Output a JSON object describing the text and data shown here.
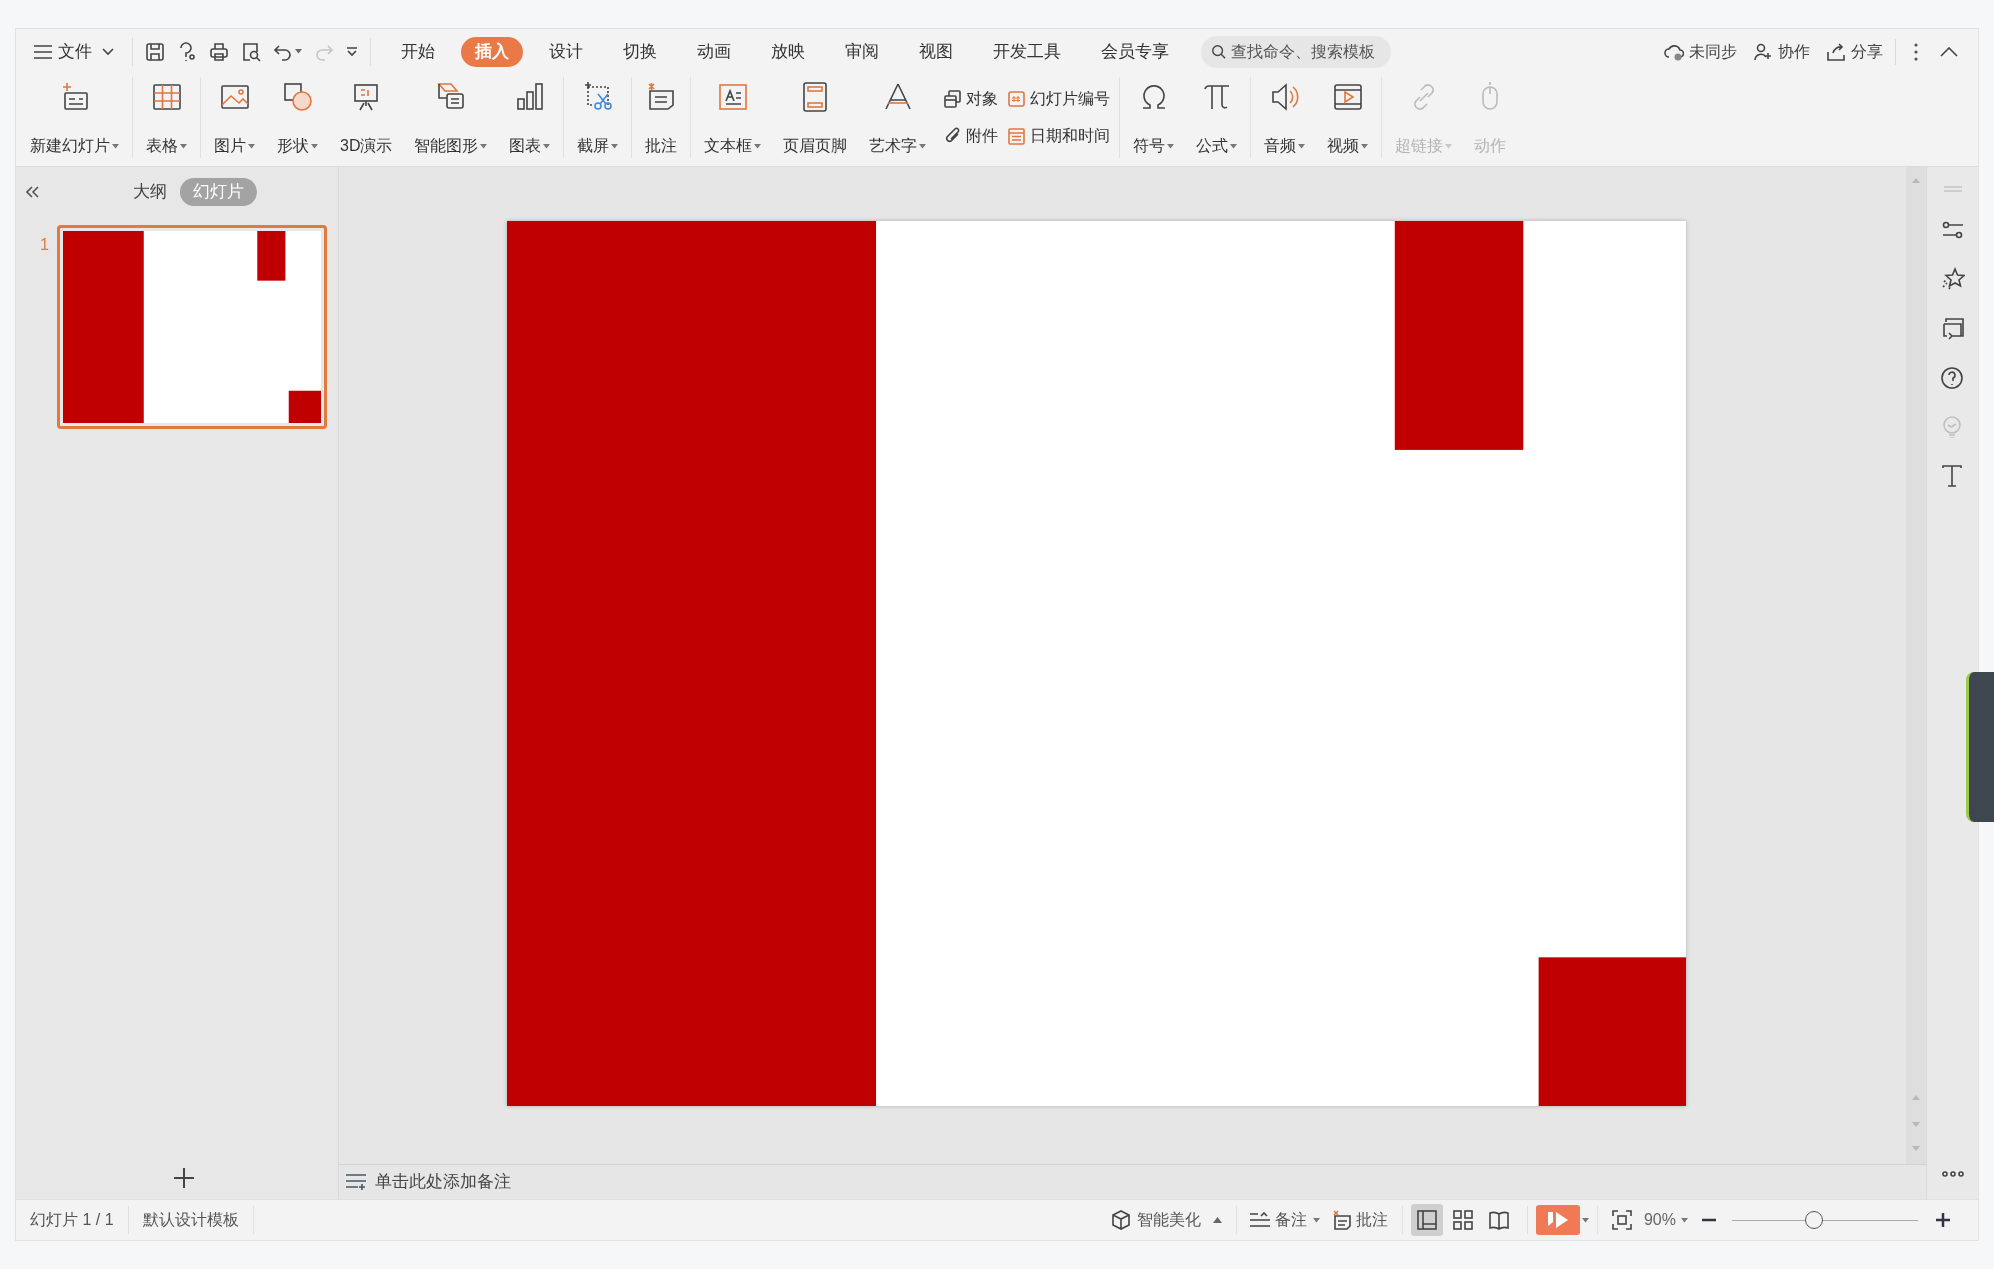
{
  "file_menu": {
    "label": "文件"
  },
  "tabs": [
    {
      "label": "开始",
      "selected": false
    },
    {
      "label": "插入",
      "selected": true
    },
    {
      "label": "设计",
      "selected": false
    },
    {
      "label": "切换",
      "selected": false
    },
    {
      "label": "动画",
      "selected": false
    },
    {
      "label": "放映",
      "selected": false
    },
    {
      "label": "审阅",
      "selected": false
    },
    {
      "label": "视图",
      "selected": false
    },
    {
      "label": "开发工具",
      "selected": false
    },
    {
      "label": "会员专享",
      "selected": false
    }
  ],
  "search": {
    "placeholder": "查找命令、搜索模板"
  },
  "top_actions": [
    "未同步",
    "协作",
    "分享"
  ],
  "ribbon": [
    {
      "items": [
        {
          "kind": "large",
          "label": "新建幻灯片",
          "dropdown": true,
          "disabled": false
        }
      ]
    },
    {
      "items": [
        {
          "kind": "large",
          "label": "表格",
          "dropdown": true,
          "disabled": false
        }
      ]
    },
    {
      "items": [
        {
          "kind": "large",
          "label": "图片",
          "dropdown": true,
          "disabled": false
        },
        {
          "kind": "large",
          "label": "形状",
          "dropdown": true,
          "disabled": false
        },
        {
          "kind": "large",
          "label": "3D演示",
          "dropdown": false,
          "disabled": false
        },
        {
          "kind": "large",
          "label": "智能图形",
          "dropdown": true,
          "disabled": false
        },
        {
          "kind": "large",
          "label": "图表",
          "dropdown": true,
          "disabled": false
        }
      ]
    },
    {
      "items": [
        {
          "kind": "large",
          "label": "截屏",
          "dropdown": true,
          "disabled": false
        }
      ]
    },
    {
      "items": [
        {
          "kind": "large",
          "label": "批注",
          "dropdown": false,
          "disabled": false
        }
      ]
    },
    {
      "items": [
        {
          "kind": "large",
          "label": "文本框",
          "dropdown": true,
          "disabled": false
        },
        {
          "kind": "large",
          "label": "页眉页脚",
          "dropdown": false,
          "disabled": false
        },
        {
          "kind": "large",
          "label": "艺术字",
          "dropdown": true,
          "disabled": false
        },
        {
          "kind": "small",
          "label": "对象",
          "dropdown": false,
          "disabled": false
        },
        {
          "kind": "small",
          "label": "附件",
          "dropdown": false,
          "disabled": false
        },
        {
          "kind": "small",
          "label": "幻灯片编号",
          "dropdown": false,
          "disabled": false
        },
        {
          "kind": "small",
          "label": "日期和时间",
          "dropdown": false,
          "disabled": false
        }
      ]
    },
    {
      "items": [
        {
          "kind": "large",
          "label": "符号",
          "dropdown": true,
          "disabled": false
        },
        {
          "kind": "large",
          "label": "公式",
          "dropdown": true,
          "disabled": false
        }
      ]
    },
    {
      "items": [
        {
          "kind": "large",
          "label": "音频",
          "dropdown": true,
          "disabled": false
        },
        {
          "kind": "large",
          "label": "视频",
          "dropdown": true,
          "disabled": false
        }
      ]
    },
    {
      "items": [
        {
          "kind": "large",
          "label": "超链接",
          "dropdown": true,
          "disabled": true
        },
        {
          "kind": "large",
          "label": "动作",
          "dropdown": false,
          "disabled": true
        }
      ]
    }
  ],
  "left_panel": {
    "view_tabs": [
      {
        "label": "大纲",
        "selected": false
      },
      {
        "label": "幻灯片",
        "selected": true
      }
    ],
    "thumbnails": [
      {
        "number": "1",
        "selected": true
      }
    ]
  },
  "notes": {
    "placeholder": "单击此处添加备注"
  },
  "status_bar": {
    "slide_count": "幻灯片 1 / 1",
    "template": "默认设计模板",
    "smart_beautify": "智能美化",
    "notes": "备注",
    "comments": "批注",
    "views": [
      {
        "selected": true
      },
      {
        "selected": false
      },
      {
        "selected": false
      }
    ],
    "zoom": "90%",
    "zoom_slider": {
      "level": 0.44
    }
  }
}
